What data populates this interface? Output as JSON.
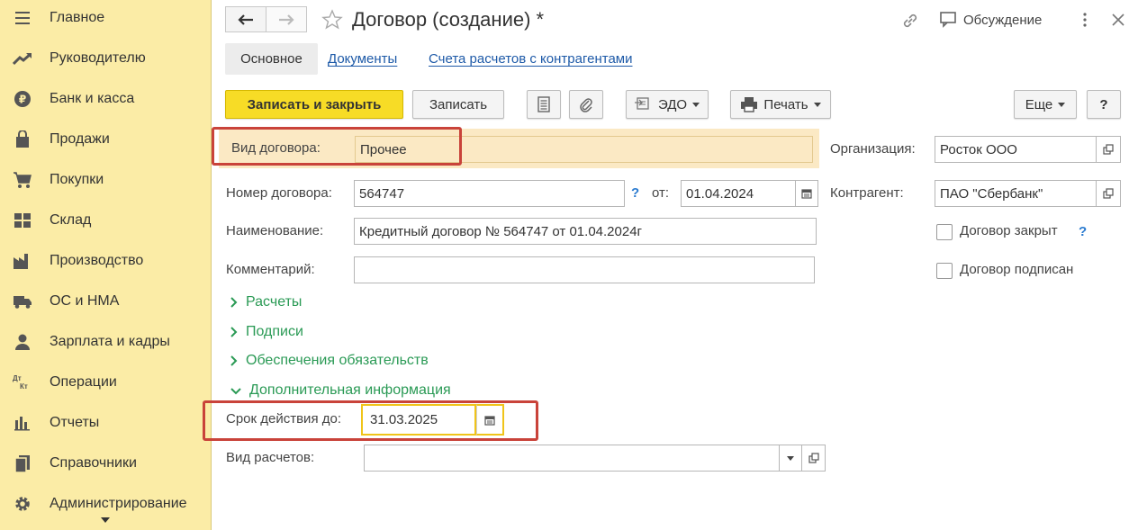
{
  "sidebar": {
    "items": [
      {
        "label": "Главное",
        "icon": "menu-icon"
      },
      {
        "label": "Руководителю",
        "icon": "trend-icon"
      },
      {
        "label": "Банк и касса",
        "icon": "coin-icon"
      },
      {
        "label": "Продажи",
        "icon": "bag-icon"
      },
      {
        "label": "Покупки",
        "icon": "cart-icon"
      },
      {
        "label": "Склад",
        "icon": "warehouse-icon"
      },
      {
        "label": "Производство",
        "icon": "factory-icon"
      },
      {
        "label": "ОС и НМА",
        "icon": "truck-icon"
      },
      {
        "label": "Зарплата и кадры",
        "icon": "person-icon"
      },
      {
        "label": "Операции",
        "icon": "dt-kt-icon"
      },
      {
        "label": "Отчеты",
        "icon": "bar-chart-icon"
      },
      {
        "label": "Справочники",
        "icon": "books-icon"
      },
      {
        "label": "Администрирование",
        "icon": "gear-icon"
      }
    ],
    "dt_text": "Дт",
    "kt_text": "Кт"
  },
  "header": {
    "title": "Договор (создание) *",
    "discussion": "Обсуждение"
  },
  "tabs": {
    "main": "Основное",
    "documents": "Документы",
    "accounts": "Счета расчетов с контрагентами"
  },
  "toolbar": {
    "save_close": "Записать и закрыть",
    "save": "Записать",
    "edo": "ЭДО",
    "print": "Печать",
    "more": "Еще",
    "help": "?"
  },
  "form": {
    "contract_type_label": "Вид договора:",
    "contract_type_value": "Прочее",
    "number_label": "Номер договора:",
    "number_value": "564747",
    "date_from_label": "от:",
    "date_value": "01.04.2024",
    "name_label": "Наименование:",
    "name_value": "Кредитный договор № 564747 от 01.04.2024г",
    "comment_label": "Комментарий:",
    "comment_value": "",
    "org_label": "Организация:",
    "org_value": "Росток ООО",
    "counterparty_label": "Контрагент:",
    "counterparty_value": "ПАО \"Сбербанк\"",
    "closed_label": "Договор закрыт",
    "signed_label": "Договор подписан",
    "help_mark": "?",
    "groups": {
      "payments": "Расчеты",
      "signatures": "Подписи",
      "obligations": "Обеспечения обязательств",
      "additional": "Дополнительная информация"
    },
    "valid_until_label": "Срок действия до:",
    "valid_until_value": "31.03.2025",
    "payment_type_label": "Вид расчетов:",
    "payment_type_value": ""
  },
  "colors": {
    "sidebar_bg": "#fbeca6",
    "primary_button": "#f7dc26",
    "link": "#1e5aa8",
    "group_green": "#2a9a55",
    "highlight_red": "#c9433a",
    "highlight_field": "#fbe9c4"
  }
}
